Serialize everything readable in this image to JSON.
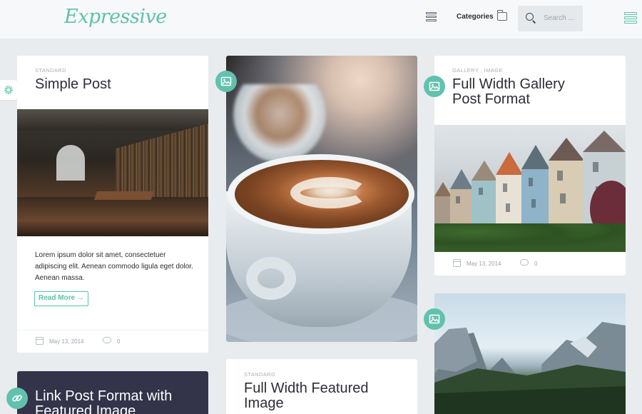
{
  "header": {
    "logo": "Expressive",
    "categories_label": "Categories",
    "search_placeholder": "Search ..."
  },
  "posts": {
    "simple": {
      "category": "STANDARD",
      "title": "Simple Post",
      "excerpt": "Lorem ipsum dolor sit amet, consectetuer adipiscing elit. Aenean commodo ligula eget dolor. Aenean massa.",
      "read_more": "Read More →",
      "date": "May 13, 2014",
      "comments": "0"
    },
    "gallery": {
      "category": "GALLERY , IMAGE",
      "title": "Full Width Gallery Post Format",
      "date": "May 13, 2014",
      "comments": "0"
    },
    "featured": {
      "category": "STANDARD",
      "title": "Full Width Featured Image"
    },
    "link": {
      "title": "Link Post Format with Featured Image"
    }
  },
  "icons": {
    "accent_color": "#5cc3a8",
    "badge_color": "#62c1ad",
    "gear": "gear-icon",
    "image": "image-icon",
    "link": "link-icon"
  }
}
